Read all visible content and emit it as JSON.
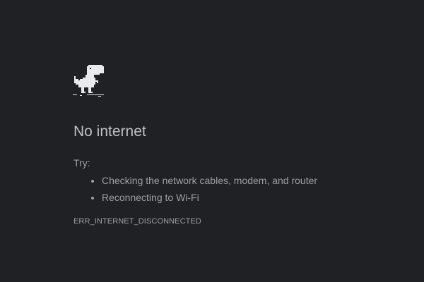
{
  "colors": {
    "background": "#202124",
    "headline": "#bdc1c6",
    "body_text": "#9aa0a6",
    "dino": "#e8eaed"
  },
  "icon": "offline-dinosaur-icon",
  "headline": "No internet",
  "try_label": "Try:",
  "suggestions": [
    "Checking the network cables, modem, and router",
    "Reconnecting to Wi-Fi"
  ],
  "error_code": "ERR_INTERNET_DISCONNECTED"
}
